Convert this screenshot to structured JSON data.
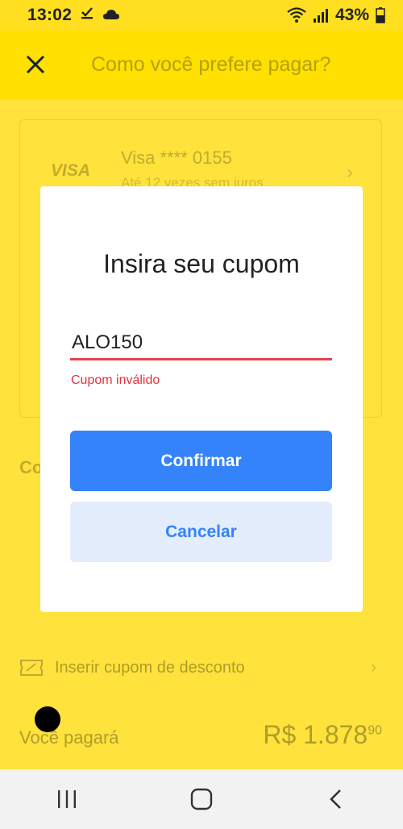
{
  "status_bar": {
    "time": "13:02",
    "battery": "43%"
  },
  "header": {
    "title": "Como você prefere pagar?",
    "close_icon": "close-icon"
  },
  "background": {
    "card_brand": "VISA",
    "card_name": "Visa **** 0155",
    "card_subtitle": "Até 12 vezes sem juros",
    "section_label": "Co",
    "coupon_label": "Inserir cupom de desconto",
    "pay_label": "Você pagará",
    "pay_amount": "R$ 1.878",
    "pay_cents": "90"
  },
  "modal": {
    "title": "Insira seu cupom",
    "input_value": "ALO150",
    "error": "Cupom inválido",
    "confirm_label": "Confirmar",
    "cancel_label": "Cancelar"
  },
  "colors": {
    "primary": "#3483FA",
    "error": "#E0313F",
    "background": "#FFE000"
  }
}
